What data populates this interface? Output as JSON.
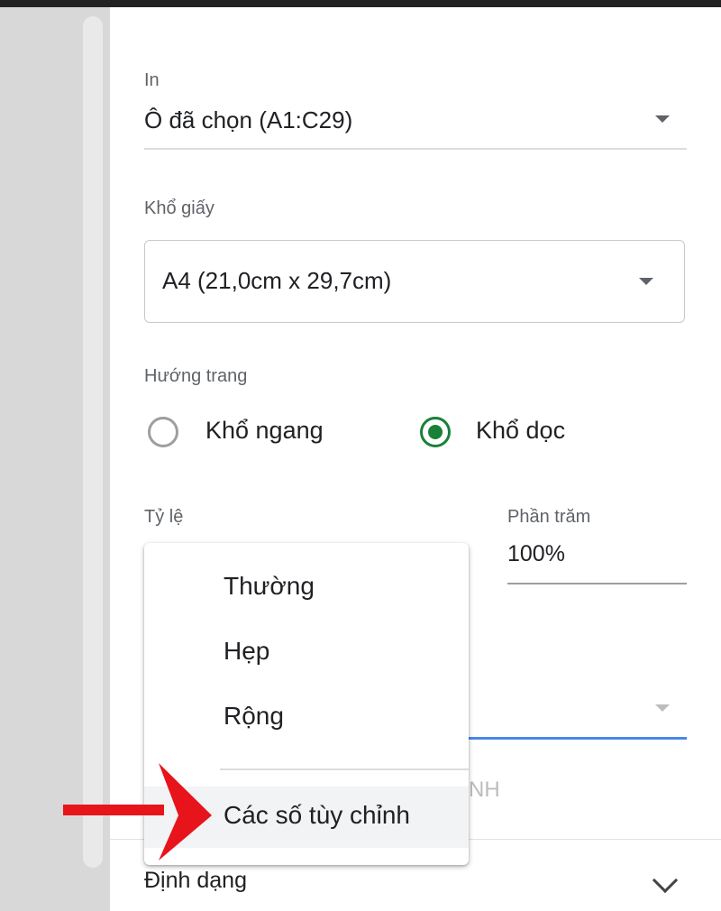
{
  "print": {
    "label": "In",
    "value": "Ô đã chọn (A1:C29)"
  },
  "paper_size": {
    "label": "Khổ giấy",
    "value": "A4 (21,0cm x 29,7cm)"
  },
  "orientation": {
    "label": "Hướng trang",
    "options": [
      {
        "label": "Khổ ngang",
        "selected": false
      },
      {
        "label": "Khổ dọc",
        "selected": true
      }
    ]
  },
  "scale": {
    "label": "Tỷ lệ",
    "percent_label": "Phần trăm",
    "percent_value": "100%"
  },
  "margins_menu": {
    "items": [
      "Thường",
      "Hẹp",
      "Rộng"
    ],
    "custom_item": "Các số tùy chỉnh"
  },
  "obscured_text": "NH",
  "format_section": {
    "label": "Định dạng"
  },
  "colors": {
    "selected_radio": "#188038",
    "focus_underline": "#4a86e8",
    "annotation_arrow": "#e8141b"
  },
  "icons": [
    "dropdown-caret-icon",
    "chevron-down-icon",
    "red-arrow-annotation"
  ]
}
